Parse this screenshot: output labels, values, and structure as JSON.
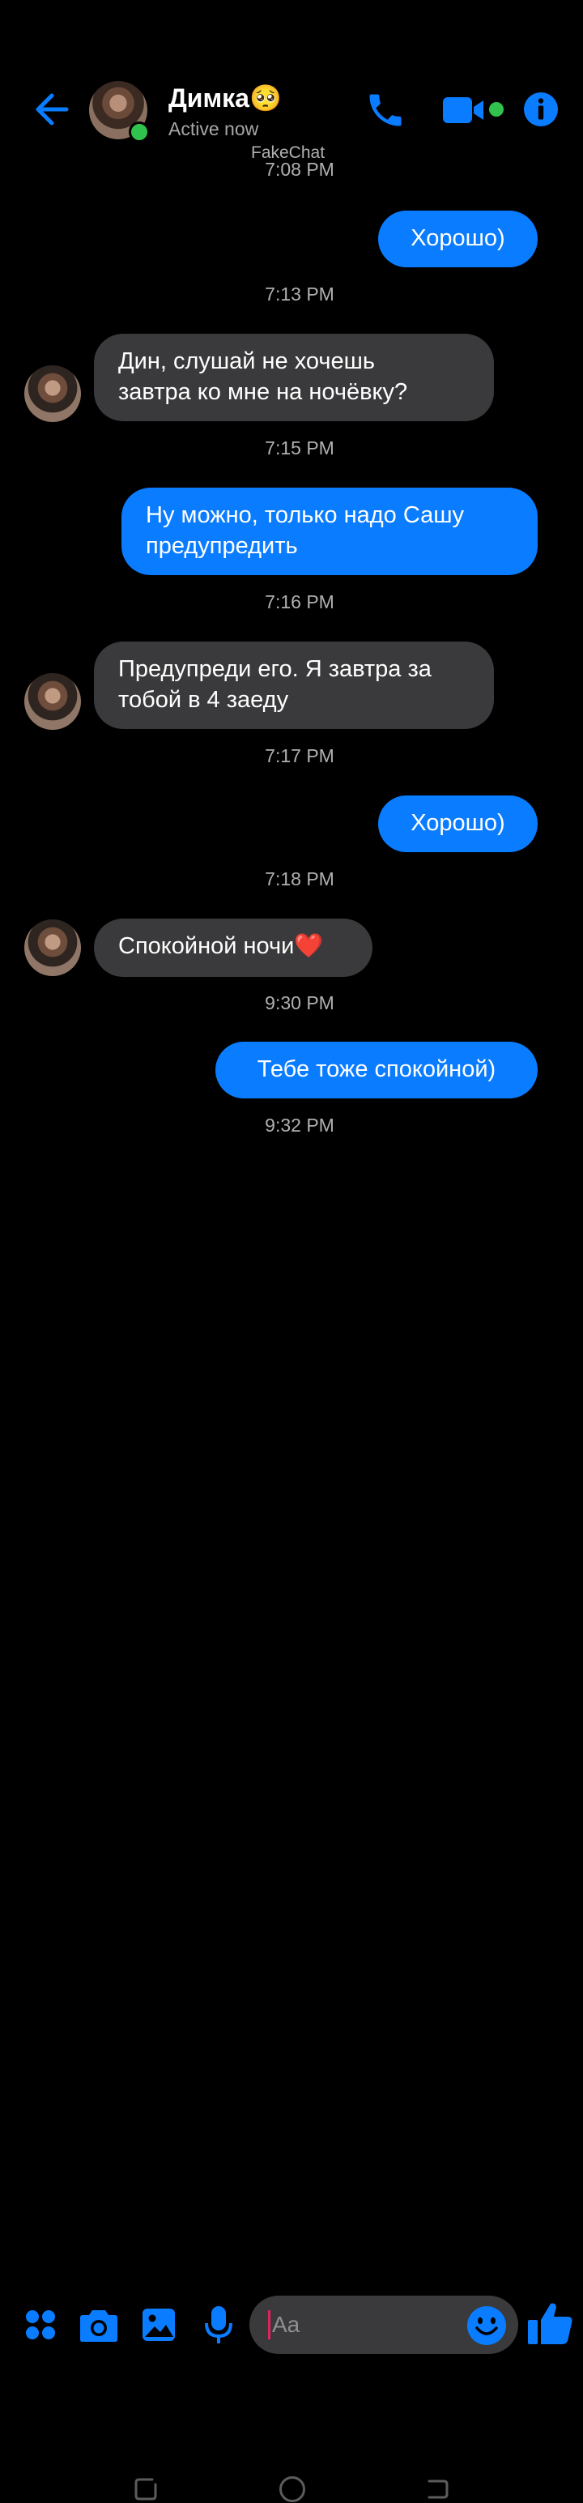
{
  "header": {
    "contact_name": "Димка🥺",
    "status": "Active now",
    "watermark": "FakeChat",
    "colors": {
      "accent": "#0a7cff",
      "online": "#31c24d"
    },
    "icons": [
      "back-arrow-icon",
      "phone-icon",
      "video-camera-icon",
      "info-icon"
    ]
  },
  "messages": [
    {
      "type": "timestamp",
      "text": "7:08 PM"
    },
    {
      "type": "outgoing",
      "text": "Хорошо)"
    },
    {
      "type": "timestamp",
      "text": "7:13 PM"
    },
    {
      "type": "incoming",
      "lines": [
        "Дин, слушай не хочешь",
        "завтра ко мне на ночёвку?"
      ]
    },
    {
      "type": "timestamp",
      "text": "7:15 PM"
    },
    {
      "type": "outgoing",
      "lines": [
        "Ну можно, только надо Сашу",
        "предупредить"
      ]
    },
    {
      "type": "timestamp",
      "text": "7:16 PM"
    },
    {
      "type": "incoming",
      "lines": [
        "Предупреди его. Я завтра за",
        "тобой в 4 заеду"
      ]
    },
    {
      "type": "timestamp",
      "text": "7:17 PM"
    },
    {
      "type": "outgoing",
      "text": "Хорошо)"
    },
    {
      "type": "timestamp",
      "text": "7:18 PM"
    },
    {
      "type": "incoming",
      "text": "Спокойной ночи❤️"
    },
    {
      "type": "timestamp",
      "text": "9:30 PM"
    },
    {
      "type": "outgoing",
      "text": "Тебе тоже спокойной)"
    },
    {
      "type": "timestamp",
      "text": "9:32 PM"
    }
  ],
  "composer": {
    "placeholder": "Aa",
    "icons": [
      "apps-grid-icon",
      "camera-icon",
      "gallery-icon",
      "microphone-icon",
      "emoji-icon",
      "thumbs-up-icon"
    ]
  },
  "navbar": {
    "icons": [
      "recent-apps-icon",
      "home-icon",
      "back-icon"
    ]
  }
}
